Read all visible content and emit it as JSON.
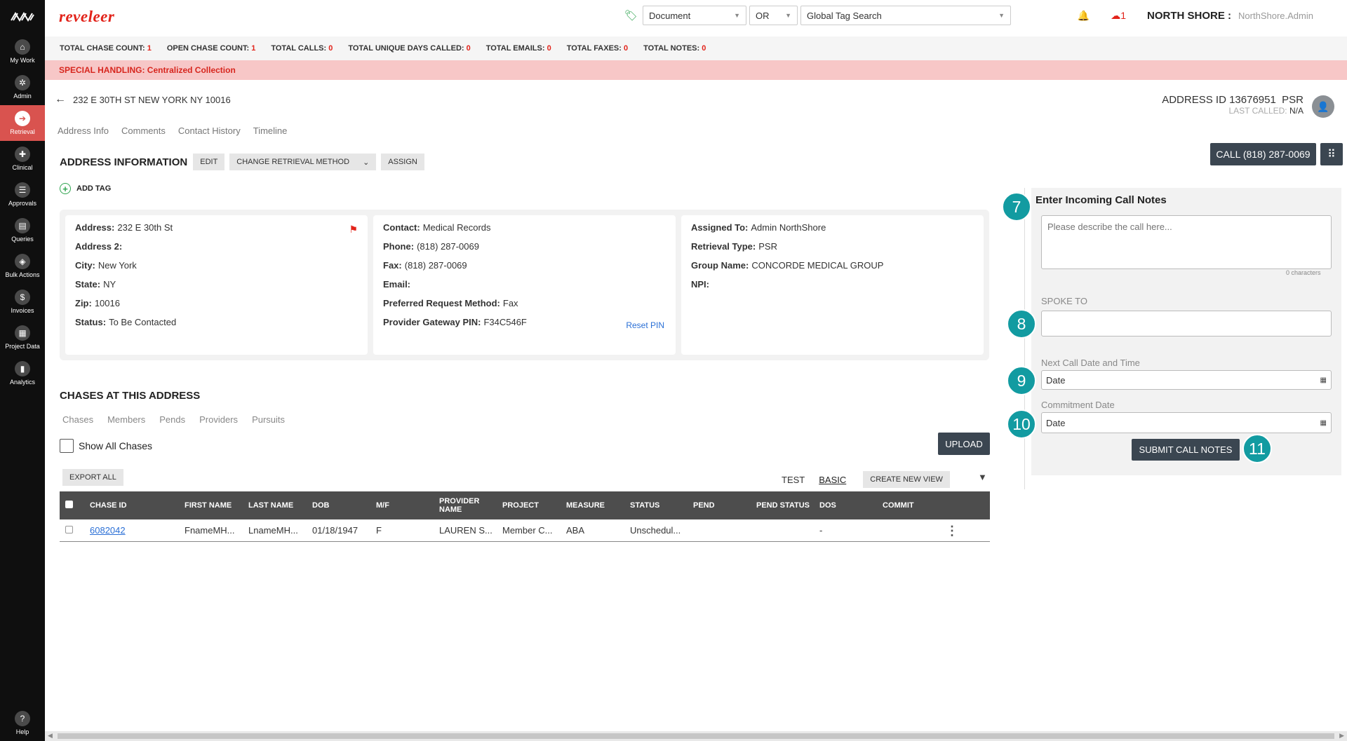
{
  "sidebar": {
    "items": [
      {
        "label": "My Work",
        "icon": "home-icon",
        "glyph": "⌂"
      },
      {
        "label": "Admin",
        "icon": "gear-icon",
        "glyph": "✲"
      },
      {
        "label": "Retrieval",
        "icon": "retrieval-icon",
        "glyph": "➔"
      },
      {
        "label": "Clinical",
        "icon": "clinical-icon",
        "glyph": "✚"
      },
      {
        "label": "Approvals",
        "icon": "approvals-icon",
        "glyph": "☰"
      },
      {
        "label": "Queries",
        "icon": "queries-icon",
        "glyph": "▤"
      },
      {
        "label": "Bulk Actions",
        "icon": "layers-icon",
        "glyph": "◈"
      },
      {
        "label": "Invoices",
        "icon": "dollar-icon",
        "glyph": "$"
      },
      {
        "label": "Project Data",
        "icon": "project-data-icon",
        "glyph": "▦"
      },
      {
        "label": "Analytics",
        "icon": "analytics-icon",
        "glyph": "▮"
      }
    ],
    "help": {
      "label": "Help",
      "glyph": "?"
    }
  },
  "header": {
    "brand": "reveleer",
    "doc_select": "Document",
    "or_select": "OR",
    "tag_search": "Global Tag Search",
    "cloud_count": "1",
    "org": "NORTH SHORE :",
    "user": "NorthShore.Admin"
  },
  "stats": [
    {
      "label": "TOTAL CHASE COUNT:",
      "value": "1"
    },
    {
      "label": "OPEN CHASE COUNT:",
      "value": "1"
    },
    {
      "label": "TOTAL CALLS:",
      "value": "0"
    },
    {
      "label": "TOTAL UNIQUE DAYS CALLED:",
      "value": "0"
    },
    {
      "label": "TOTAL EMAILS:",
      "value": "0"
    },
    {
      "label": "TOTAL FAXES:",
      "value": "0"
    },
    {
      "label": "TOTAL NOTES:",
      "value": "0"
    }
  ],
  "special_handling": "SPECIAL HANDLING: Centralized Collection",
  "page": {
    "address_title": "232 E 30TH ST NEW YORK NY 10016",
    "address_id": "ADDRESS ID 13676951",
    "psr": "PSR",
    "last_called_label": "LAST CALLED:",
    "last_called_value": "N/A",
    "tabs": [
      "Address Info",
      "Comments",
      "Contact History",
      "Timeline"
    ]
  },
  "address_info": {
    "heading": "ADDRESS INFORMATION",
    "edit": "EDIT",
    "change_method": "CHANGE RETRIEVAL METHOD",
    "assign": "ASSIGN",
    "add_tag": "ADD TAG",
    "col1": [
      {
        "k": "Address:",
        "v": "232 E 30th St"
      },
      {
        "k": "Address 2:",
        "v": ""
      },
      {
        "k": "City:",
        "v": "New York"
      },
      {
        "k": "State:",
        "v": "NY"
      },
      {
        "k": "Zip:",
        "v": "10016"
      },
      {
        "k": "Status:",
        "v": "To Be Contacted"
      }
    ],
    "col2": [
      {
        "k": "Contact:",
        "v": "Medical Records"
      },
      {
        "k": "Phone:",
        "v": "(818) 287-0069"
      },
      {
        "k": "Fax:",
        "v": "(818) 287-0069"
      },
      {
        "k": "Email:",
        "v": ""
      },
      {
        "k": "Preferred Request Method:",
        "v": "Fax"
      },
      {
        "k": "Provider Gateway PIN:",
        "v": "F34C546F"
      }
    ],
    "reset_pin": "Reset PIN",
    "col3": [
      {
        "k": "Assigned To:",
        "v": "Admin NorthShore"
      },
      {
        "k": "Retrieval Type:",
        "v": "PSR"
      },
      {
        "k": "Group Name:",
        "v": "CONCORDE MEDICAL GROUP"
      },
      {
        "k": "NPI:",
        "v": ""
      }
    ]
  },
  "chases": {
    "heading": "CHASES AT THIS ADDRESS",
    "tabs": [
      "Chases",
      "Members",
      "Pends",
      "Providers",
      "Pursuits"
    ],
    "show_all": "Show All Chases",
    "upload": "UPLOAD",
    "export_all": "EXPORT ALL",
    "view_test": "TEST",
    "view_basic": "BASIC",
    "create_view": "CREATE NEW VIEW",
    "columns": [
      "CHASE ID",
      "FIRST NAME",
      "LAST NAME",
      "DOB",
      "M/F",
      "PROVIDER NAME",
      "PROJECT",
      "MEASURE",
      "STATUS",
      "PEND",
      "PEND STATUS",
      "DOS",
      "COMMIT"
    ],
    "rows": [
      [
        "6082042",
        "FnameMH...",
        "LnameMH...",
        "01/18/1947",
        "F",
        "LAUREN S...",
        "Member C...",
        "ABA",
        "Unschedul...",
        "",
        "",
        "-",
        ""
      ]
    ]
  },
  "call_panel": {
    "call_button": "CALL (818) 287-0069",
    "title": "Enter Incoming Call Notes",
    "notes_placeholder": "Please describe the call here...",
    "char_count": "0 characters",
    "spoke_to_label": "SPOKE TO",
    "next_call_label": "Next Call Date and Time",
    "next_call_value": "Date",
    "commitment_label": "Commitment Date",
    "commitment_value": "Date",
    "submit": "SUBMIT CALL NOTES",
    "badges": [
      "7",
      "8",
      "9",
      "10",
      "11"
    ]
  },
  "colors": {
    "brand": "#e2231a",
    "sidebar": "#0f0f0f",
    "active_nav": "#d9534f",
    "badge": "#129ba1",
    "dark_button": "#3b4651"
  }
}
